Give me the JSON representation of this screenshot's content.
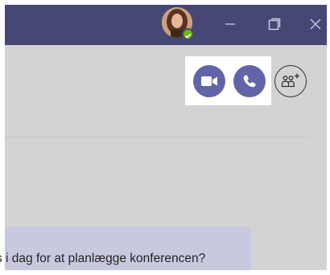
{
  "window": {
    "controls": [
      "minimize-icon",
      "restore-icon",
      "close-icon"
    ],
    "titlebar_color": "#464775"
  },
  "user": {
    "avatar_icon": "profile-photo",
    "presence": "available",
    "presence_color": "#6bb700"
  },
  "header_actions": {
    "video_call_icon": "video-camera-icon",
    "audio_call_icon": "phone-icon",
    "add_people_icon": "add-people-icon",
    "accent_color": "#6264a7"
  },
  "chat": {
    "messages": [
      {
        "text": "s i dag for at planlægge konferencen?"
      }
    ]
  }
}
